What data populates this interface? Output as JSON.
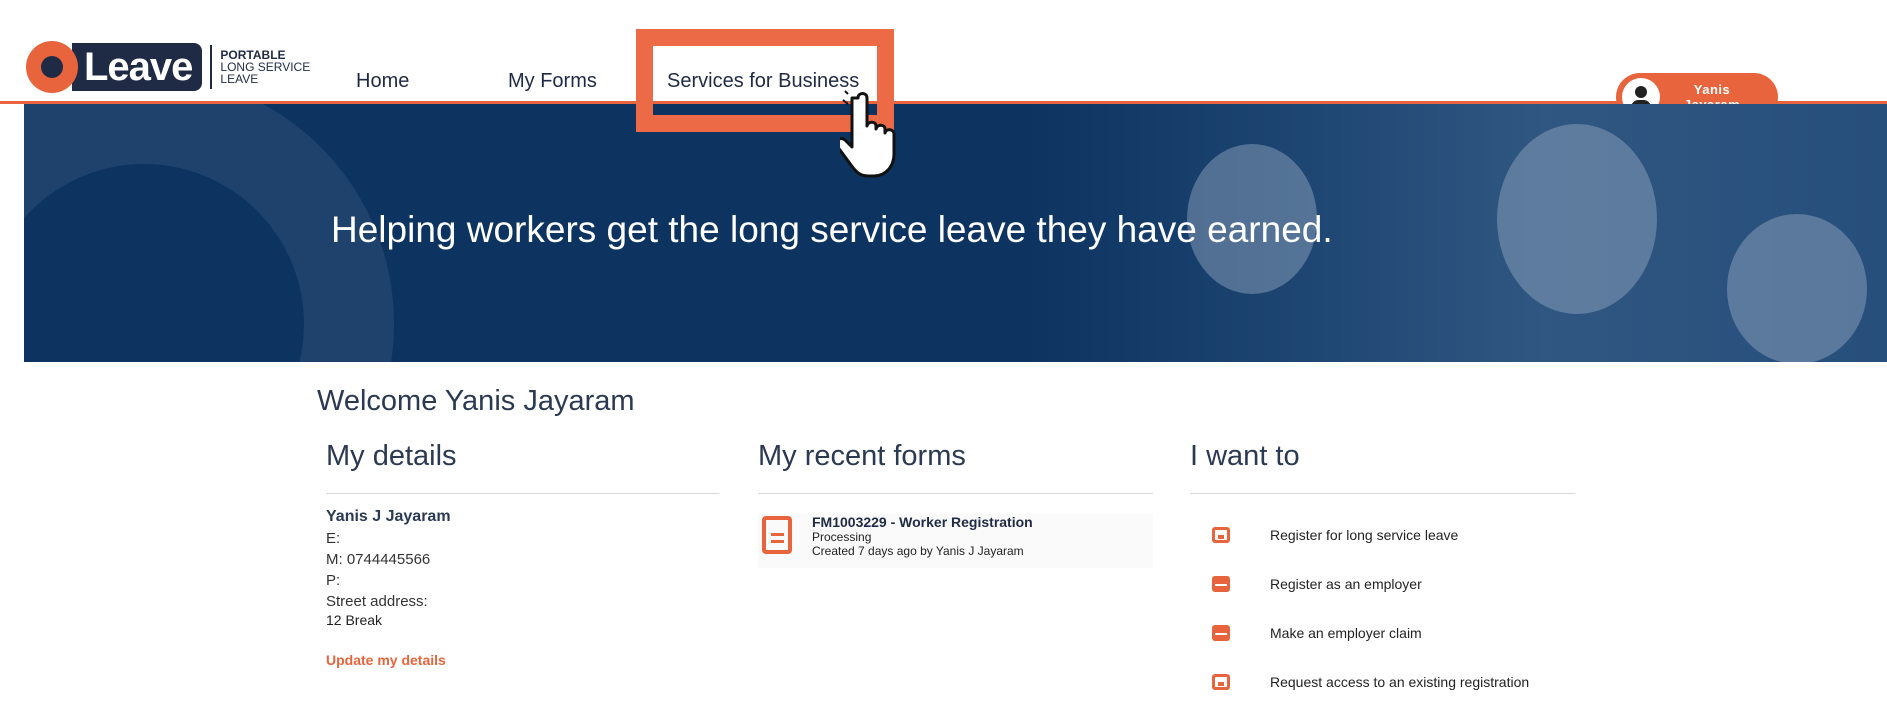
{
  "brand": {
    "logo_word": "Leave",
    "logo_sub": [
      "PORTABLE",
      "LONG SERVICE",
      "LEAVE"
    ]
  },
  "nav": {
    "home": "Home",
    "my_forms": "My Forms",
    "services": "Services for Business"
  },
  "user": {
    "name_line1": "Yanis",
    "name_line2": "Jayaram"
  },
  "hero": {
    "headline": "Helping workers get the long service leave they have earned."
  },
  "welcome": "Welcome Yanis Jayaram",
  "details": {
    "heading": "My details",
    "name": "Yanis J Jayaram",
    "email": "E:",
    "mobile": "M: 0744445566",
    "phone": "P:",
    "street_label": "Street address:",
    "street_value": "12 Break",
    "update_link": "Update my details"
  },
  "recent_forms": {
    "heading": "My recent forms",
    "items": [
      {
        "title": "FM1003229 - Worker Registration",
        "status": "Processing",
        "created": "Created 7 days ago by Yanis J Jayaram"
      }
    ]
  },
  "i_want_to": {
    "heading": "I want to",
    "items": [
      {
        "label": "Register for long service leave",
        "icon": "inbox-icon"
      },
      {
        "label": "Register as an employer",
        "icon": "open-envelope-icon"
      },
      {
        "label": "Make an employer claim",
        "icon": "open-envelope-icon"
      },
      {
        "label": "Request access to an existing registration",
        "icon": "inbox-icon"
      }
    ]
  },
  "colors": {
    "accent": "#e8643c",
    "navy": "#0d3461",
    "text_dark": "#2a3a52"
  }
}
